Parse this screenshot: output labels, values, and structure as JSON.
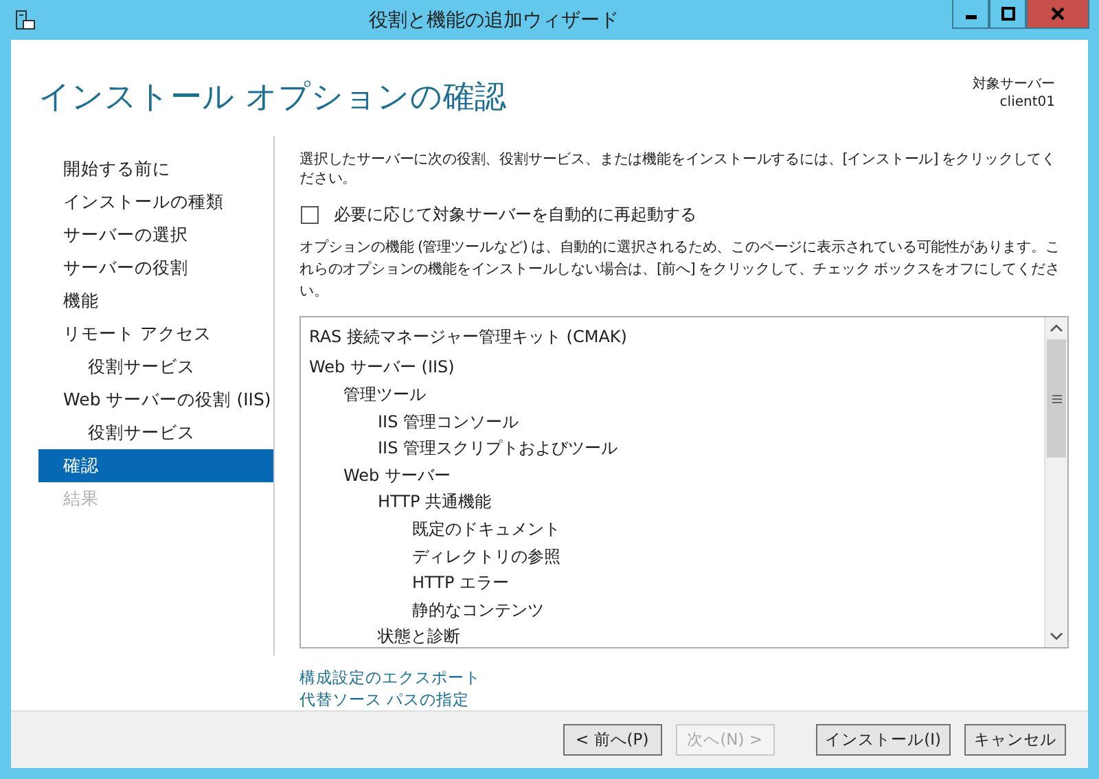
{
  "window": {
    "title": "役割と機能の追加ウィザード"
  },
  "header": {
    "title": "インストール オプションの確認",
    "target_label": "対象サーバー",
    "target_value": "client01"
  },
  "sidebar": {
    "items": [
      {
        "label": "開始する前に",
        "selected": false,
        "disabled": false
      },
      {
        "label": "インストールの種類",
        "selected": false,
        "disabled": false
      },
      {
        "label": "サーバーの選択",
        "selected": false,
        "disabled": false
      },
      {
        "label": "サーバーの役割",
        "selected": false,
        "disabled": false
      },
      {
        "label": "機能",
        "selected": false,
        "disabled": false
      },
      {
        "label": "リモート アクセス",
        "selected": false,
        "disabled": false,
        "children": [
          {
            "label": "役割サービス",
            "selected": false,
            "disabled": false
          }
        ]
      },
      {
        "label": "Web サーバーの役割 (IIS)",
        "selected": false,
        "disabled": false,
        "children": [
          {
            "label": "役割サービス",
            "selected": false,
            "disabled": false
          }
        ]
      },
      {
        "label": "確認",
        "selected": true,
        "disabled": false
      },
      {
        "label": "結果",
        "selected": false,
        "disabled": true
      }
    ]
  },
  "content": {
    "intro": "選択したサーバーに次の役割、役割サービス、または機能をインストールするには、[インストール] をクリックしてください。",
    "restart_checkbox": {
      "label": "必要に応じて対象サーバーを自動的に再起動する",
      "checked": false
    },
    "note": "オプションの機能 (管理ツールなど) は、自動的に選択されるため、このページに表示されている可能性があります。これらのオプションの機能をインストールしない場合は、[前へ] をクリックして、チェック ボックスをオフにしてください。",
    "features": [
      {
        "label": "RAS 接続マネージャー管理キット (CMAK)"
      },
      {
        "label": "Web サーバー (IIS)",
        "children": [
          {
            "label": "管理ツール",
            "children": [
              {
                "label": "IIS 管理コンソール"
              },
              {
                "label": "IIS 管理スクリプトおよびツール"
              }
            ]
          },
          {
            "label": "Web サーバー",
            "children": [
              {
                "label": "HTTP 共通機能",
                "children": [
                  {
                    "label": "既定のドキュメント"
                  },
                  {
                    "label": "ディレクトリの参照"
                  },
                  {
                    "label": "HTTP エラー"
                  },
                  {
                    "label": "静的なコンテンツ"
                  }
                ]
              },
              {
                "label": "状態と診断"
              }
            ]
          }
        ]
      }
    ],
    "links": [
      "構成設定のエクスポート",
      "代替ソース パスの指定"
    ]
  },
  "buttons": [
    {
      "label": "< 前へ(P)",
      "disabled": false
    },
    {
      "label": "次へ(N) >",
      "disabled": true
    },
    {
      "label": "インストール(I)",
      "disabled": false
    },
    {
      "label": "キャンセル",
      "disabled": false
    }
  ]
}
